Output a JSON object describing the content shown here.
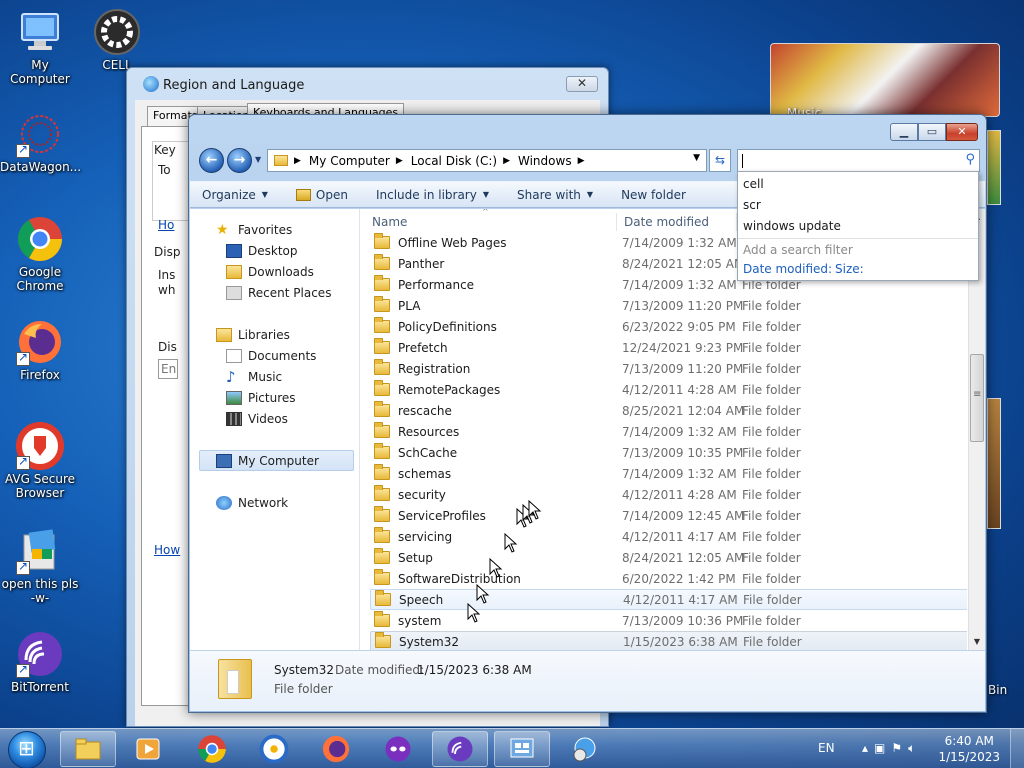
{
  "desktop": {
    "icons": [
      {
        "label": "My Computer"
      },
      {
        "label": "CELL"
      },
      {
        "label": "DataWagon..."
      },
      {
        "label": "Google Chrome"
      },
      {
        "label": "Firefox"
      },
      {
        "label": "AVG Secure Browser"
      },
      {
        "label": "open this pls -w-"
      },
      {
        "label": "BitTorrent"
      }
    ],
    "recycle_bin_label": "Bin",
    "gadget_label": "Music"
  },
  "region_dialog": {
    "title": "Region and Language",
    "close_label": "✕",
    "tabs": [
      "Formats",
      "Location",
      "Keyboards and Languages"
    ],
    "fragments": {
      "key": "Key",
      "to": "To",
      "ho": "Ho",
      "disp": "Disp",
      "ins": "Ins",
      "wh": "wh",
      "dis": "Dis",
      "en": "En",
      "how": "How"
    }
  },
  "explorer": {
    "address": {
      "crumbs": [
        "My Computer",
        "Local Disk (C:)",
        "Windows"
      ]
    },
    "search": {
      "value": ""
    },
    "toolbar": {
      "organize": "Organize",
      "open": "Open",
      "include_in_library": "Include in library",
      "share_with": "Share with",
      "new_folder": "New folder"
    },
    "nav": {
      "favorites": "Favorites",
      "desktop": "Desktop",
      "downloads": "Downloads",
      "recent_places": "Recent Places",
      "libraries": "Libraries",
      "documents": "Documents",
      "music": "Music",
      "pictures": "Pictures",
      "videos": "Videos",
      "my_computer": "My Computer",
      "network": "Network"
    },
    "columns": {
      "name": "Name",
      "date_modified": "Date modified"
    },
    "files": [
      {
        "name": "Offline Web Pages",
        "date": "7/14/2009 1:32 AM",
        "type": "File folder"
      },
      {
        "name": "Panther",
        "date": "8/24/2021 12:05 AM",
        "type": "File folder"
      },
      {
        "name": "Performance",
        "date": "7/14/2009 1:32 AM",
        "type": "File folder"
      },
      {
        "name": "PLA",
        "date": "7/13/2009 11:20 PM",
        "type": "File folder"
      },
      {
        "name": "PolicyDefinitions",
        "date": "6/23/2022 9:05 PM",
        "type": "File folder"
      },
      {
        "name": "Prefetch",
        "date": "12/24/2021 9:23 PM",
        "type": "File folder"
      },
      {
        "name": "Registration",
        "date": "7/13/2009 11:20 PM",
        "type": "File folder"
      },
      {
        "name": "RemotePackages",
        "date": "4/12/2011 4:28 AM",
        "type": "File folder"
      },
      {
        "name": "rescache",
        "date": "8/25/2021 12:04 AM",
        "type": "File folder"
      },
      {
        "name": "Resources",
        "date": "7/14/2009 1:32 AM",
        "type": "File folder"
      },
      {
        "name": "SchCache",
        "date": "7/13/2009 10:35 PM",
        "type": "File folder"
      },
      {
        "name": "schemas",
        "date": "7/14/2009 1:32 AM",
        "type": "File folder"
      },
      {
        "name": "security",
        "date": "4/12/2011 4:28 AM",
        "type": "File folder"
      },
      {
        "name": "ServiceProfiles",
        "date": "7/14/2009 12:45 AM",
        "type": "File folder"
      },
      {
        "name": "servicing",
        "date": "4/12/2011 4:17 AM",
        "type": "File folder"
      },
      {
        "name": "Setup",
        "date": "8/24/2021 12:05 AM",
        "type": "File folder"
      },
      {
        "name": "SoftwareDistribution",
        "date": "6/20/2022 1:42 PM",
        "type": "File folder"
      },
      {
        "name": "Speech",
        "date": "4/12/2011 4:17 AM",
        "type": "File folder"
      },
      {
        "name": "system",
        "date": "7/13/2009 10:36 PM",
        "type": "File folder"
      },
      {
        "name": "System32",
        "date": "1/15/2023 6:38 AM",
        "type": "File folder"
      }
    ],
    "details": {
      "name": "System32",
      "date_label": "Date modified:",
      "date_value": "1/15/2023 6:38 AM",
      "type": "File folder"
    },
    "suggestions": {
      "items": [
        "cell",
        "scr",
        "windows update"
      ],
      "hint": "Add a search filter",
      "filter_date": "Date modified:",
      "filter_size": "Size:"
    }
  },
  "taskbar": {
    "lang": "EN",
    "time": "6:40 AM",
    "date": "1/15/2023"
  }
}
